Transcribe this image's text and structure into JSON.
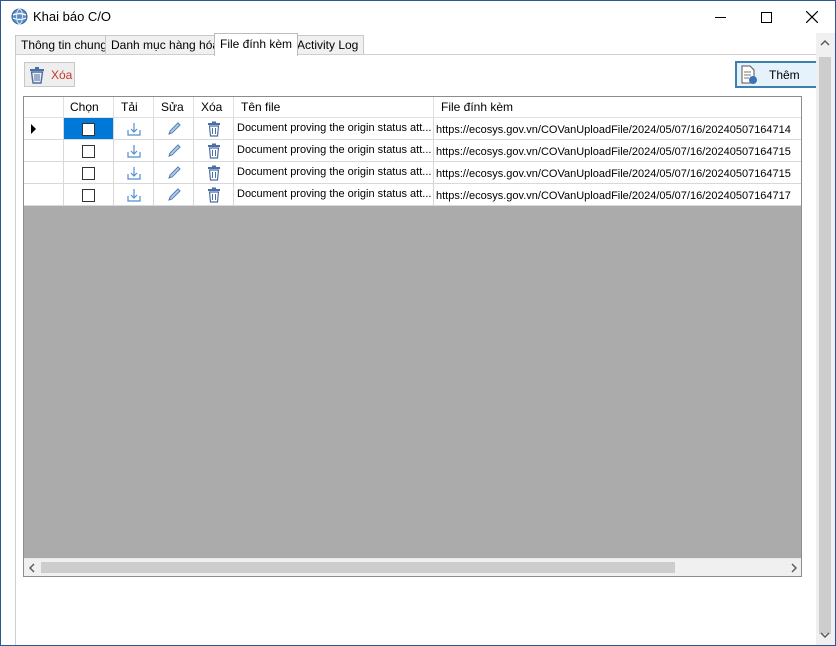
{
  "window": {
    "title": "Khai báo C/O"
  },
  "tabs": [
    {
      "label": "Thông tin chung",
      "active": false
    },
    {
      "label": "Danh mục hàng hóa",
      "active": false
    },
    {
      "label": "File đính kèm",
      "active": true
    },
    {
      "label": "Activity Log",
      "active": false
    }
  ],
  "toolbar": {
    "delete_label": "Xóa",
    "add_label": "Thêm"
  },
  "colors": {
    "selection": "#0078d7",
    "grid_empty": "#ababab",
    "delete_text": "#c0392b",
    "accent_border": "#3c7fb1"
  },
  "grid": {
    "columns": [
      "Chọn",
      "Tải",
      "Sửa",
      "Xóa",
      "Tên file",
      "File đính kèm"
    ],
    "rows": [
      {
        "checked": false,
        "filename": "Document proving the origin status att...",
        "url": "https://ecosys.gov.vn/COVanUploadFile/2024/05/07/16/20240507164714"
      },
      {
        "checked": false,
        "filename": "Document proving the origin status att...",
        "url": "https://ecosys.gov.vn/COVanUploadFile/2024/05/07/16/20240507164715"
      },
      {
        "checked": false,
        "filename": "Document proving the origin status att...",
        "url": "https://ecosys.gov.vn/COVanUploadFile/2024/05/07/16/20240507164715"
      },
      {
        "checked": false,
        "filename": "Document proving the origin status att...",
        "url": "https://ecosys.gov.vn/COVanUploadFile/2024/05/07/16/20240507164717"
      }
    ],
    "current_row": 0
  },
  "icons": {
    "app": "globe-icon",
    "minimize": "minimize-icon",
    "maximize": "maximize-icon",
    "close": "close-icon",
    "delete": "trash-icon",
    "add": "add-file-icon",
    "download": "download-icon",
    "edit": "pencil-icon",
    "row_pointer": "row-pointer-icon",
    "scroll_left": "chevron-left-icon",
    "scroll_right": "chevron-right-icon",
    "scroll_up": "chevron-up-icon",
    "scroll_down": "chevron-down-icon"
  }
}
